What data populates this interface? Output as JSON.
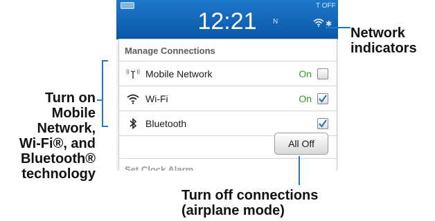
{
  "status_bar": {
    "time": "12:21",
    "network_letter": "N",
    "top_right_text": "T OFF"
  },
  "manage_connections": {
    "header": "Manage Connections",
    "items": [
      {
        "icon": "mobile-network-icon",
        "label": "Mobile Network",
        "status": "On",
        "checked": false
      },
      {
        "icon": "wifi-icon",
        "label": "Wi-Fi",
        "status": "On",
        "checked": true
      },
      {
        "icon": "bluetooth-icon",
        "label": "Bluetooth",
        "status": "",
        "checked": true
      }
    ],
    "all_off_button": "All Off",
    "next_item": "Set Clock Alarm"
  },
  "callouts": {
    "network_indicators": [
      "Network",
      "indicators"
    ],
    "turn_on": [
      "Turn on",
      "Mobile",
      "Network,",
      "Wi-Fi®, and",
      "Bluetooth®",
      "technology"
    ],
    "turn_off": [
      "Turn off connections",
      "(airplane mode)"
    ]
  },
  "colors": {
    "status_bar_blue": "#1d78c9",
    "callout_line_blue": "#1f7ad1",
    "on_green": "#2e9a2e"
  }
}
